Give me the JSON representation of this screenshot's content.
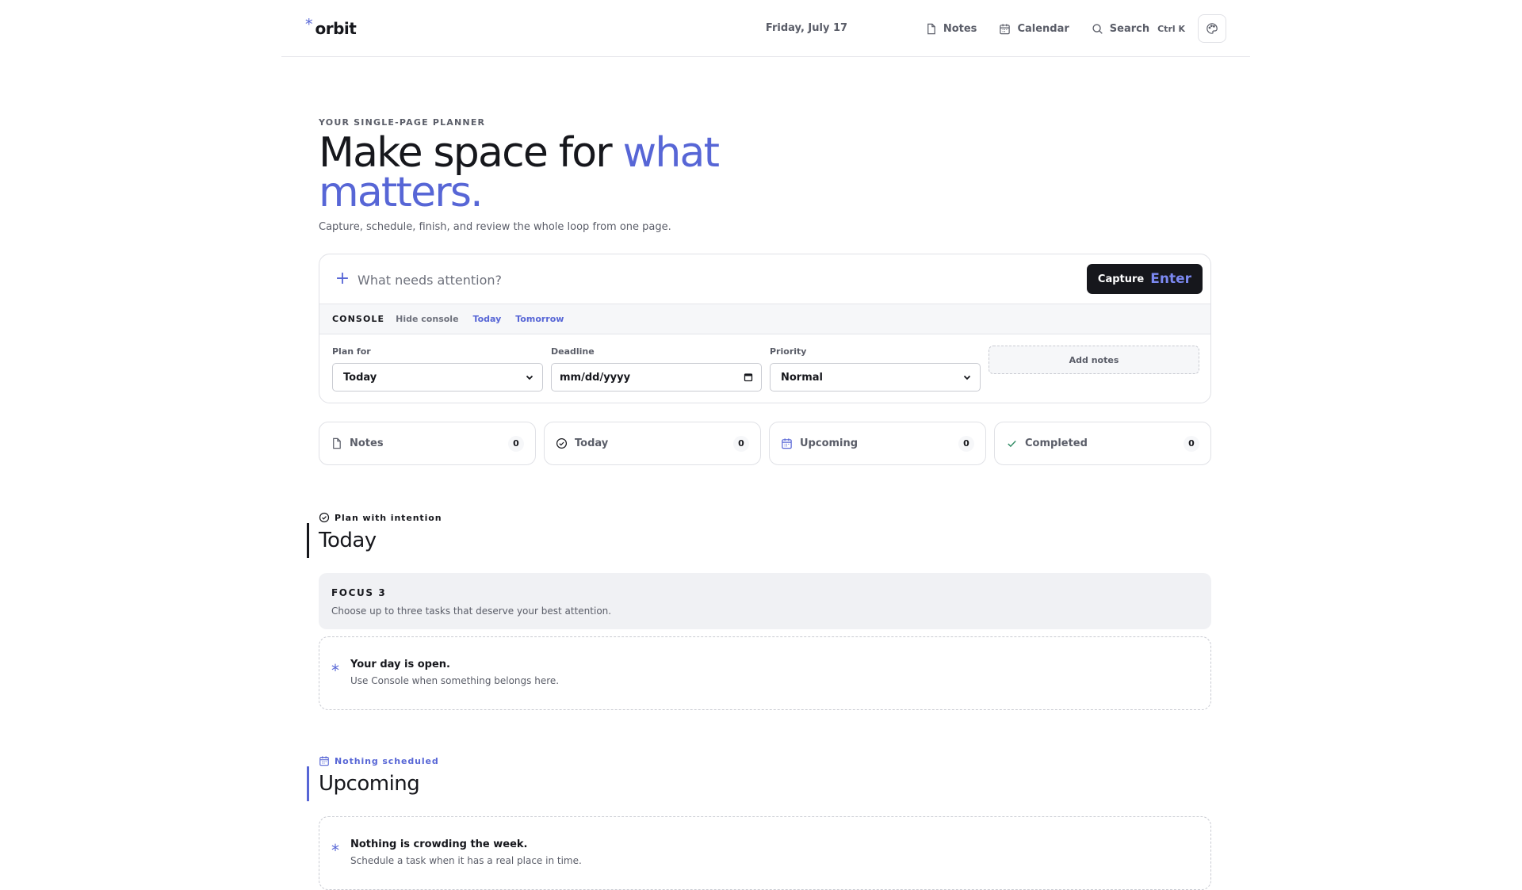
{
  "header": {
    "logo_text": "orbit",
    "date": "Friday, July 17",
    "nav": {
      "notes": "Notes",
      "calendar": "Calendar",
      "search": "Search",
      "search_shortcut": "Ctrl K"
    }
  },
  "hero": {
    "eyebrow": "YOUR SINGLE-PAGE PLANNER",
    "title_plain": "Make space for ",
    "title_accent": "what matters.",
    "subtitle": "Capture, schedule, finish, and review the whole loop from one page."
  },
  "console": {
    "input_placeholder": "What needs attention?",
    "capture_label": "Capture",
    "capture_key": "Enter",
    "title": "CONSOLE",
    "hide_label": "Hide console",
    "quick_today": "Today",
    "quick_tomorrow": "Tomorrow",
    "plan_for_label": "Plan for",
    "plan_for_value": "Today",
    "deadline_label": "Deadline",
    "deadline_placeholder": "mm/dd/yyyy",
    "priority_label": "Priority",
    "priority_value": "Normal",
    "add_notes_label": "Add notes"
  },
  "stats": [
    {
      "label": "Notes",
      "count": "0"
    },
    {
      "label": "Today",
      "count": "0"
    },
    {
      "label": "Upcoming",
      "count": "0"
    },
    {
      "label": "Completed",
      "count": "0"
    }
  ],
  "today_section": {
    "eyebrow": "Plan with intention",
    "title": "Today",
    "focus_title": "FOCUS 3",
    "focus_desc": "Choose up to three tasks that deserve your best attention.",
    "empty_title": "Your day is open.",
    "empty_desc": "Use Console when something belongs here."
  },
  "upcoming_section": {
    "eyebrow": "Nothing scheduled",
    "title": "Upcoming",
    "empty_title": "Nothing is crowding the week.",
    "empty_desc": "Schedule a task when it has a real place in time."
  },
  "colors": {
    "accent": "#5766d6",
    "ink": "#16171c",
    "muted": "#5a5d68"
  }
}
